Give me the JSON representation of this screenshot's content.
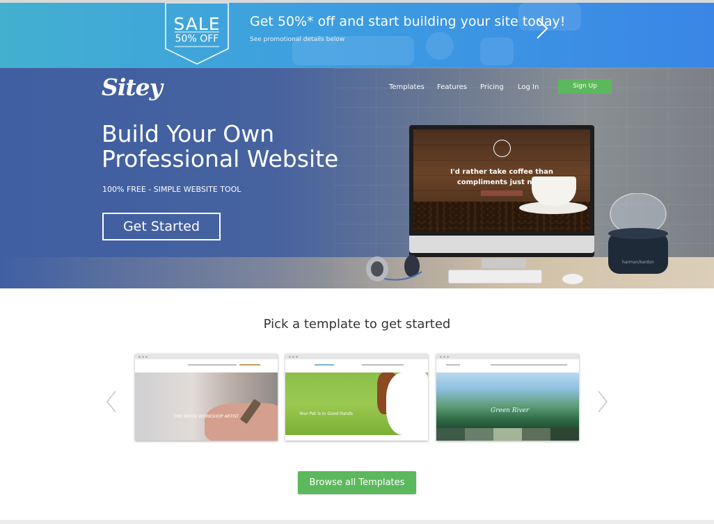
{
  "promo": {
    "sale_word": "SALE",
    "sale_off": "50% OFF",
    "headline": "Get 50%* off and start building your site today!",
    "subtext": "See promotional details below",
    "next_icon": "chevron-right-icon"
  },
  "header": {
    "logo": "Sitey",
    "nav": [
      "Templates",
      "Features",
      "Pricing",
      "Log In"
    ],
    "signup_label": "Sign Up"
  },
  "hero": {
    "title_line1": "Build Your Own",
    "title_line2": "Professional Website",
    "subtitle": "100% FREE - SIMPLE WEBSITE TOOL",
    "cta_label": "Get Started",
    "screen_message_line1": "I'd rather take coffee than",
    "screen_message_line2": "compliments just now!",
    "speaker_label": "harman/kardon"
  },
  "templates": {
    "heading": "Pick a template to get started",
    "prev_icon": "chevron-left-icon",
    "next_icon": "chevron-right-icon",
    "cards": [
      {
        "name": "wood-workshop",
        "caption": "THE WOOD WORKSHOP ARTIST"
      },
      {
        "name": "pet-care",
        "caption": "Your Pet Is In Good Hands"
      },
      {
        "name": "green-river",
        "caption": "Green River"
      }
    ],
    "browse_label": "Browse all Templates"
  },
  "colors": {
    "promo_start": "#43b0d0",
    "promo_end": "#3a86e6",
    "hero_blue": "#3f5fa2",
    "green": "#5cb85c"
  }
}
